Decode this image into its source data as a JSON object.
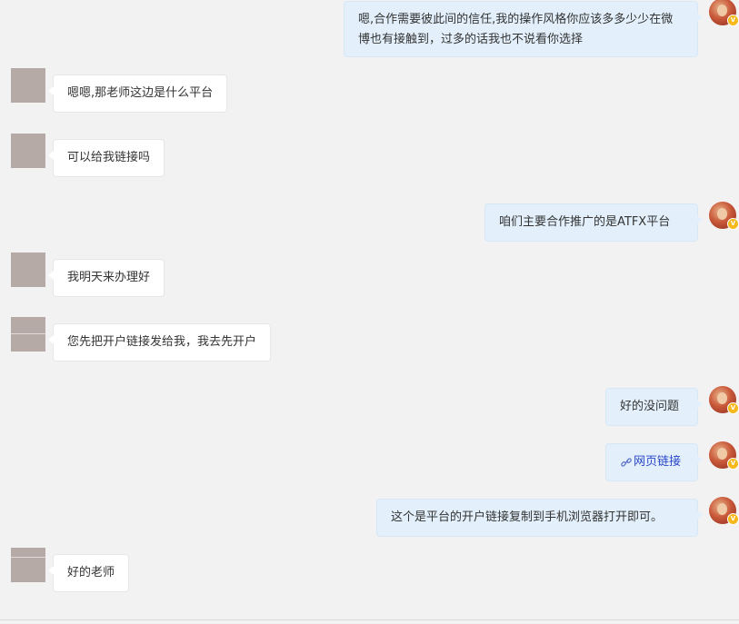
{
  "messages": [
    {
      "sender": "self",
      "text": "嗯,合作需要彼此间的信任,我的操作风格你应该多多少少在微博也有接触到，过多的话我也不说看你选择"
    },
    {
      "sender": "peer",
      "text": "嗯嗯,那老师这边是什么平台"
    },
    {
      "sender": "peer",
      "text": "可以给我链接吗"
    },
    {
      "sender": "self",
      "text": "咱们主要合作推广的是ATFX平台"
    },
    {
      "sender": "peer",
      "text": "我明天来办理好"
    },
    {
      "sender": "peer",
      "text": "您先把开户链接发给我，我去先开户"
    },
    {
      "sender": "self",
      "text": "好的没问题"
    },
    {
      "sender": "self",
      "text": "网页链接",
      "type": "link",
      "icon": "link-icon"
    },
    {
      "sender": "self",
      "text": "这个是平台的开户链接复制到手机浏览器打开即可。"
    },
    {
      "sender": "peer",
      "text": "好的老师"
    }
  ],
  "avatars": {
    "self_badge": "V"
  },
  "colors": {
    "background": "#f2f2f2",
    "peer_bubble": "#ffffff",
    "self_bubble": "#e3f0fb",
    "link": "#2b46c9",
    "badge": "#f6b81a"
  }
}
